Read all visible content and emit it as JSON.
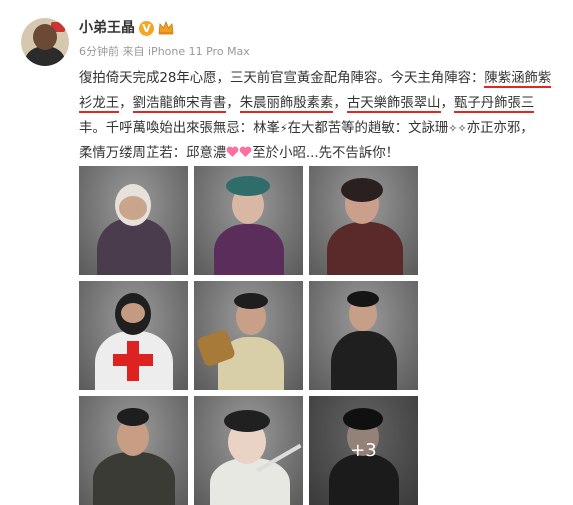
{
  "post": {
    "author": "小弟王晶",
    "time": "6分钟前",
    "source_prefix": "来自",
    "source": "iPhone 11 Pro Max",
    "text": {
      "p1": "復拍倚天完成28年心愿，三天前官宣黃金配角陣容。今天主角陣容：",
      "u1": "陳紫涵飾紫",
      "u2": "衫龙王",
      "p2": "，",
      "u3": "劉浩龍飾宋青書",
      "p3": "，",
      "u4": "朱晨丽飾殷素素",
      "p4": "，",
      "u5": "古天樂飾張翠山",
      "p5": "，",
      "u6": "甄子丹飾張三",
      "line3a": "丰。千呼萬喚始出來張無忌：林峯",
      "line3b": "在大都苦等的趙敏：文詠珊",
      "line3c": "亦正亦邪，",
      "line4a": "柔情万缕周芷若：邱意濃",
      "line4b": "至於小昭...先不告訴你！"
    },
    "photos": [
      {
        "name": "photo-1"
      },
      {
        "name": "photo-2"
      },
      {
        "name": "photo-3"
      },
      {
        "name": "photo-4"
      },
      {
        "name": "photo-5"
      },
      {
        "name": "photo-6"
      },
      {
        "name": "photo-7"
      },
      {
        "name": "photo-8"
      },
      {
        "name": "photo-9"
      }
    ],
    "more_count": "+3"
  },
  "icons": {
    "verified": "v-badge-icon",
    "member": "crown-icon",
    "heart": "heart-icon",
    "sparkle": "sparkle-icon"
  },
  "colors": {
    "underline": "#e0281f",
    "badge": "#f5a623",
    "meta": "#999999"
  }
}
